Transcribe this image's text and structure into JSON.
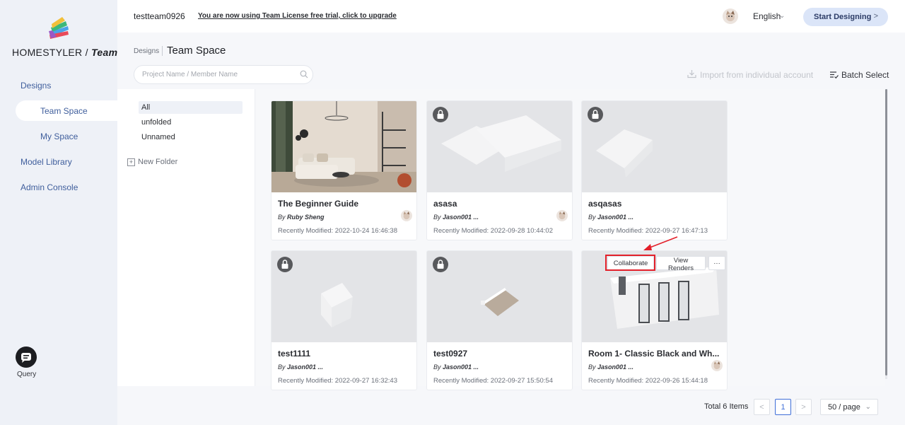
{
  "brand": {
    "name": "HOMESTYLER",
    "sep": "/",
    "suffix": "Team"
  },
  "sidebar": {
    "items": [
      {
        "label": "Designs"
      },
      {
        "label": "Team Space"
      },
      {
        "label": "My Space"
      },
      {
        "label": "Model Library"
      },
      {
        "label": "Admin Console"
      }
    ],
    "query_label": "Query"
  },
  "topbar": {
    "team_name": "testteam0926",
    "trial_text": "You are now using Team License free trial, click to upgrade",
    "language": "English",
    "start_label": "Start Designing",
    "start_chev": ">"
  },
  "header": {
    "breadcrumb": "Designs",
    "title": "Team Space",
    "search_placeholder": "Project Name / Member Name",
    "import_label": "Import from individual account",
    "batch_label": "Batch Select"
  },
  "folders": {
    "items": [
      {
        "label": "All"
      },
      {
        "label": "unfolded"
      },
      {
        "label": "Unnamed"
      }
    ],
    "new_folder": "New Folder"
  },
  "cards": [
    {
      "title": "The Beginner Guide",
      "by_prefix": "By",
      "author": "Ruby Sheng",
      "modified": "Recently Modified: 2022-10-24 16:46:38",
      "locked": false
    },
    {
      "title": "asasa",
      "by_prefix": "By",
      "author": "Jason001 ...",
      "modified": "Recently Modified: 2022-09-28 10:44:02",
      "locked": true
    },
    {
      "title": "asqasas",
      "by_prefix": "By",
      "author": "Jason001 ...",
      "modified": "Recently Modified: 2022-09-27 16:47:13",
      "locked": true
    },
    {
      "title": "test1111",
      "by_prefix": "By",
      "author": "Jason001 ...",
      "modified": "Recently Modified: 2022-09-27 16:32:43",
      "locked": true
    },
    {
      "title": "test0927",
      "by_prefix": "By",
      "author": "Jason001 ...",
      "modified": "Recently Modified: 2022-09-27 15:50:54",
      "locked": true
    },
    {
      "title": "Room 1- Classic Black and Wh...",
      "by_prefix": "By",
      "author": "Jason001 ...",
      "modified": "Recently Modified: 2022-09-26 15:44:18",
      "locked": false
    }
  ],
  "hover_actions": {
    "collaborate": "Collaborate",
    "view_renders": "View Renders",
    "more": "···"
  },
  "pagination": {
    "total": "Total 6 Items",
    "prev": "<",
    "current": "1",
    "next": ">",
    "per_page": "50 / page"
  },
  "colors": {
    "accent": "#3f6fd8",
    "highlight": "#e3202a",
    "sidebar_bg": "#eef1f7"
  }
}
